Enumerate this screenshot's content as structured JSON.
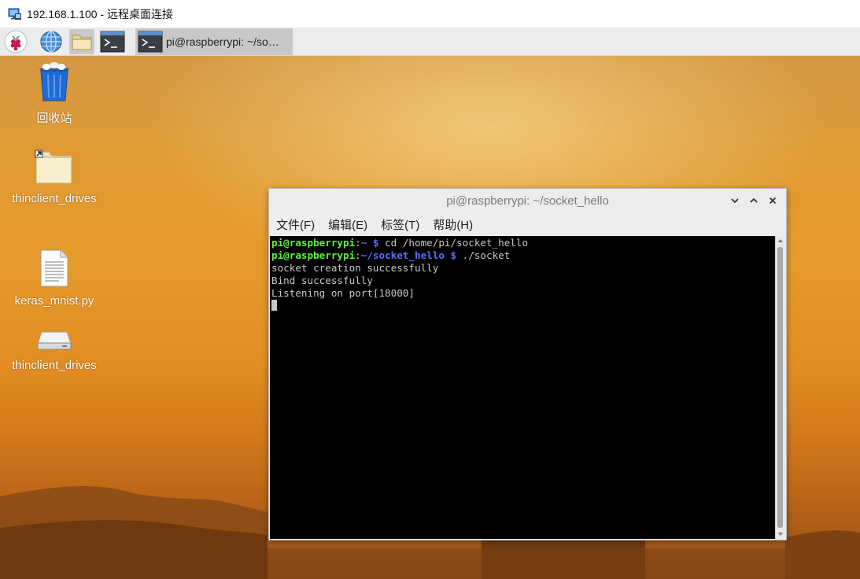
{
  "rdp": {
    "title": "192.168.1.100 - 远程桌面连接"
  },
  "panel": {
    "launchers": [
      {
        "icon": "raspberry-pi-menu-icon"
      },
      {
        "icon": "web-browser-globe-icon"
      },
      {
        "icon": "file-manager-folder-icon"
      },
      {
        "icon": "terminal-icon"
      }
    ],
    "task": {
      "icon": "terminal-icon",
      "label": "pi@raspberrypi: ~/so…"
    }
  },
  "desktop": {
    "icons": [
      {
        "label": "回收站",
        "icon": "trash-bin-icon"
      },
      {
        "label": "thinclient_drives",
        "icon": "folder-shortcut-icon"
      },
      {
        "label": "keras_mnist.py",
        "icon": "text-file-icon"
      },
      {
        "label": "thinclient_drives",
        "icon": "drive-icon"
      }
    ]
  },
  "terminal": {
    "title": "pi@raspberrypi: ~/socket_hello",
    "menu": [
      "文件(F)",
      "编辑(E)",
      "标签(T)",
      "帮助(H)"
    ],
    "lines": [
      {
        "user": "pi@raspberrypi",
        "colon": ":",
        "path": "~ $",
        "cmd": " cd /home/pi/socket_hello"
      },
      {
        "user": "pi@raspberrypi",
        "colon": ":",
        "path": "~/socket_hello $",
        "cmd": " ./socket"
      },
      {
        "text": "socket creation successfully"
      },
      {
        "text": "Bind successfully"
      },
      {
        "text": "Listening on port[18000]"
      }
    ]
  },
  "colors": {
    "prompt_user": "#5ef23c",
    "prompt_path": "#5c6cff",
    "terminal_bg": "#000000",
    "terminal_fg": "#c8c8c8"
  }
}
